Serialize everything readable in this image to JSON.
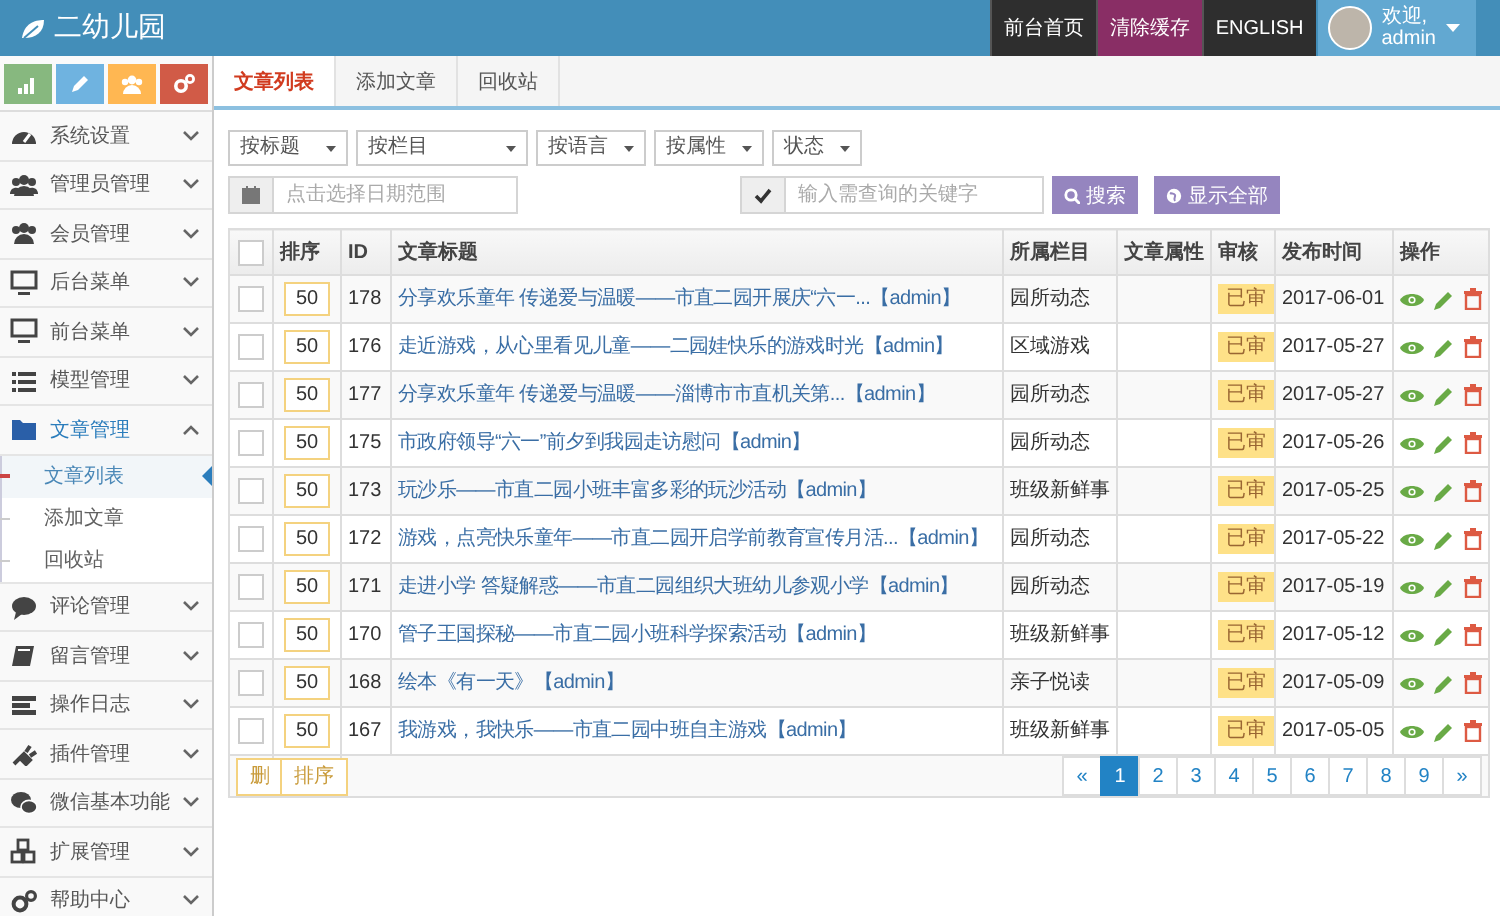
{
  "header": {
    "logo": "二幼儿园",
    "nav_buttons": [
      {
        "label": "前台首页",
        "kind": "dark"
      },
      {
        "label": "清除缓存",
        "kind": "accent"
      },
      {
        "label": "ENGLISH",
        "kind": "dark"
      }
    ],
    "user": {
      "greeting": "欢迎,",
      "name": "admin"
    }
  },
  "sidebar": {
    "shortcuts": [
      {
        "color": "#87b87f"
      },
      {
        "color": "#6fb3e0"
      },
      {
        "color": "#ffb752"
      },
      {
        "color": "#d15b47"
      }
    ],
    "items": [
      {
        "label": "系统设置",
        "expanded": false
      },
      {
        "label": "管理员管理",
        "expanded": false
      },
      {
        "label": "会员管理",
        "expanded": false
      },
      {
        "label": "后台菜单",
        "expanded": false
      },
      {
        "label": "前台菜单",
        "expanded": false
      },
      {
        "label": "模型管理",
        "expanded": false
      },
      {
        "label": "文章管理",
        "expanded": true,
        "children": [
          {
            "label": "文章列表",
            "selected": true
          },
          {
            "label": "添加文章",
            "selected": false
          },
          {
            "label": "回收站",
            "selected": false
          }
        ]
      },
      {
        "label": "评论管理",
        "expanded": false
      },
      {
        "label": "留言管理",
        "expanded": false
      },
      {
        "label": "操作日志",
        "expanded": false
      },
      {
        "label": "插件管理",
        "expanded": false
      },
      {
        "label": "微信基本功能",
        "expanded": false
      },
      {
        "label": "扩展管理",
        "expanded": false
      },
      {
        "label": "帮助中心",
        "expanded": false
      }
    ]
  },
  "tabs": [
    {
      "label": "文章列表",
      "selected": true
    },
    {
      "label": "添加文章",
      "selected": false
    },
    {
      "label": "回收站",
      "selected": false
    }
  ],
  "filters": {
    "selects": [
      {
        "label": "按标题"
      },
      {
        "label": "按栏目"
      },
      {
        "label": "按语言"
      },
      {
        "label": "按属性"
      },
      {
        "label": "状态"
      }
    ],
    "date_field": {
      "placeholder": "点击选择日期范围"
    },
    "keyword_field": {
      "placeholder": "输入需查询的关键字"
    },
    "buttons": [
      {
        "label": "搜索",
        "kind": "search"
      },
      {
        "label": "显示全部",
        "kind": "all"
      }
    ]
  },
  "table": {
    "select_all_checked": false,
    "columns": [
      "排序",
      "ID",
      "文章标题",
      "所属栏目",
      "文章属性",
      "审核",
      "发布时间",
      "操作"
    ],
    "rows": [
      {
        "checked": false,
        "sort": "50",
        "id": "178",
        "title": "分享欢乐童年 传递爱与温暖——市直二园开展庆“六一...【admin】",
        "category": "园所动态",
        "status": "已审",
        "date": "2017-06-01"
      },
      {
        "checked": false,
        "sort": "50",
        "id": "176",
        "title": "走近游戏，从心里看见儿童——二园娃快乐的游戏时光【admin】",
        "category": "区域游戏",
        "status": "已审",
        "date": "2017-05-27"
      },
      {
        "checked": false,
        "sort": "50",
        "id": "177",
        "title": "分享欢乐童年 传递爱与温暖——淄博市市直机关第...【admin】",
        "category": "园所动态",
        "status": "已审",
        "date": "2017-05-27"
      },
      {
        "checked": false,
        "sort": "50",
        "id": "175",
        "title": "市政府领导“六一”前夕到我园走访慰问【admin】",
        "category": "园所动态",
        "status": "已审",
        "date": "2017-05-26"
      },
      {
        "checked": false,
        "sort": "50",
        "id": "173",
        "title": "玩沙乐——市直二园小班丰富多彩的玩沙活动【admin】",
        "category": "班级新鲜事",
        "status": "已审",
        "date": "2017-05-25"
      },
      {
        "checked": false,
        "sort": "50",
        "id": "172",
        "title": "游戏，点亮快乐童年——市直二园开启学前教育宣传月活...【admin】",
        "category": "园所动态",
        "status": "已审",
        "date": "2017-05-22"
      },
      {
        "checked": false,
        "sort": "50",
        "id": "171",
        "title": "走进小学 答疑解惑——市直二园组织大班幼儿参观小学【admin】",
        "category": "园所动态",
        "status": "已审",
        "date": "2017-05-19"
      },
      {
        "checked": false,
        "sort": "50",
        "id": "170",
        "title": "管子王国探秘——市直二园小班科学探索活动【admin】",
        "category": "班级新鲜事",
        "status": "已审",
        "date": "2017-05-12"
      },
      {
        "checked": false,
        "sort": "50",
        "id": "168",
        "title": "绘本《有一天》【admin】",
        "category": "亲子悦读",
        "status": "已审",
        "date": "2017-05-09"
      },
      {
        "checked": false,
        "sort": "50",
        "id": "167",
        "title": "我游戏，我快乐——市直二园中班自主游戏【admin】",
        "category": "班级新鲜事",
        "status": "已审",
        "date": "2017-05-05"
      }
    ],
    "footer_buttons": [
      "删",
      "排序"
    ],
    "pagination": [
      {
        "label": "«",
        "selected": false
      },
      {
        "label": "1",
        "selected": true
      },
      {
        "label": "2",
        "selected": false
      },
      {
        "label": "3",
        "selected": false
      },
      {
        "label": "4",
        "selected": false
      },
      {
        "label": "5",
        "selected": false
      },
      {
        "label": "6",
        "selected": false
      },
      {
        "label": "7",
        "selected": false
      },
      {
        "label": "8",
        "selected": false
      },
      {
        "label": "9",
        "selected": false
      },
      {
        "label": "»",
        "selected": false
      }
    ]
  }
}
